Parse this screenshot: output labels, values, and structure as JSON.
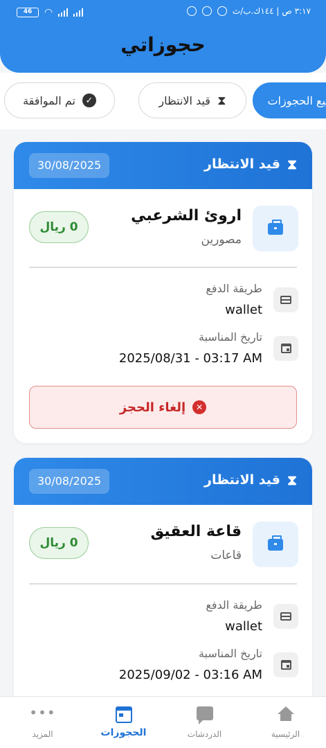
{
  "status_bar": {
    "time": "٣:١٧ ص | ١٤٤ك.ب/ث",
    "battery": "46"
  },
  "header": {
    "title": "حجوزاتي"
  },
  "tabs": [
    {
      "label": "جميع الحجوزات",
      "active": true
    },
    {
      "label": "قيد الانتظار",
      "icon": "hourglass-icon",
      "active": false
    },
    {
      "label": "تم الموافقة",
      "icon": "check-circle-icon",
      "active": false
    }
  ],
  "bookings": [
    {
      "status": "قيد الانتظار",
      "date": "30/08/2025",
      "venue_name": "اروئ الشرعبي",
      "category": "مصورين",
      "price": "0 ريال",
      "payment_label": "طريقة الدفع",
      "payment_value": "wallet",
      "event_label": "تاريخ المناسبة",
      "event_value": "2025/08/31 - 03:17 AM",
      "cancel_label": "إلغاء الحجز"
    },
    {
      "status": "قيد الانتظار",
      "date": "30/08/2025",
      "venue_name": "قاعة العقيق",
      "category": "قاعات",
      "price": "0 ريال",
      "payment_label": "طريقة الدفع",
      "payment_value": "wallet",
      "event_label": "تاريخ المناسبة",
      "event_value": "2025/09/02 - 03:16 AM"
    }
  ],
  "bottom_nav": [
    {
      "label": "الرئيسية",
      "icon": "home-icon"
    },
    {
      "label": "الدردشات",
      "icon": "chat-icon"
    },
    {
      "label": "الحجوزات",
      "icon": "calendar-icon",
      "active": true
    },
    {
      "label": "المزيد",
      "icon": "more-icon"
    }
  ],
  "colors": {
    "primary": "#2f8ae9",
    "primary_dark": "#1f73d6",
    "price_green": "#2e8b33",
    "cancel_red": "#c62828"
  }
}
